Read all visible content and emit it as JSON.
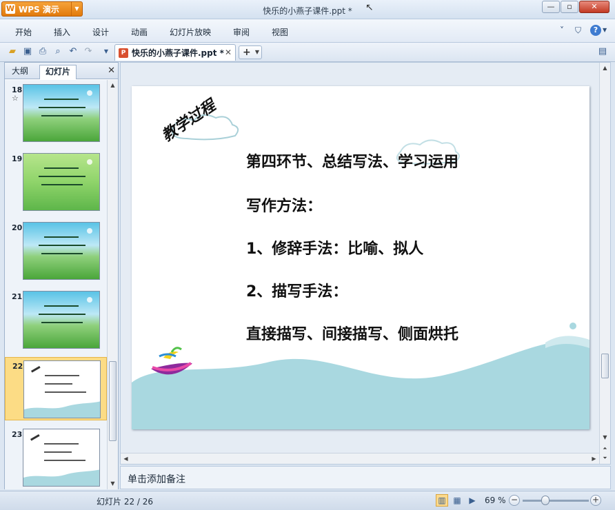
{
  "app": {
    "brand_label": "WPS 演示",
    "window_title": "快乐的小燕子课件.ppt *"
  },
  "menu": {
    "items": [
      "开始",
      "插入",
      "设计",
      "动画",
      "幻灯片放映",
      "审阅",
      "视图"
    ]
  },
  "document_tab": {
    "name": "快乐的小燕子课件.ppt *"
  },
  "left_pane": {
    "tabs": [
      "大纲",
      "幻灯片"
    ],
    "active_tab": "幻灯片",
    "thumbnails": [
      {
        "number": "18",
        "has_star": true,
        "star": "☆",
        "theme": "blue-sky",
        "selected": false
      },
      {
        "number": "19",
        "has_star": false,
        "theme": "green",
        "selected": false
      },
      {
        "number": "20",
        "has_star": false,
        "theme": "blue-sky",
        "selected": false
      },
      {
        "number": "21",
        "has_star": false,
        "theme": "blue-sky",
        "selected": false
      },
      {
        "number": "22",
        "has_star": false,
        "theme": "white-wave",
        "selected": true
      },
      {
        "number": "23",
        "has_star": false,
        "theme": "white-wave",
        "selected": false
      }
    ]
  },
  "slide": {
    "heading": "教学过程",
    "lines": [
      "第四环节、总结写法、学习运用",
      "写作方法：",
      "1、修辞手法：比喻、拟人",
      "2、描写手法：",
      "直接描写、间接描写、侧面烘托"
    ]
  },
  "notes": {
    "placeholder": "单击添加备注"
  },
  "status": {
    "slide_indicator": "幻灯片 22 / 26",
    "zoom": "69 %",
    "zoom_percent": 69
  },
  "colors": {
    "accent_orange": "#e27a0c",
    "selected_thumb": "#fcdc85",
    "wave": "#a9d8e0"
  }
}
